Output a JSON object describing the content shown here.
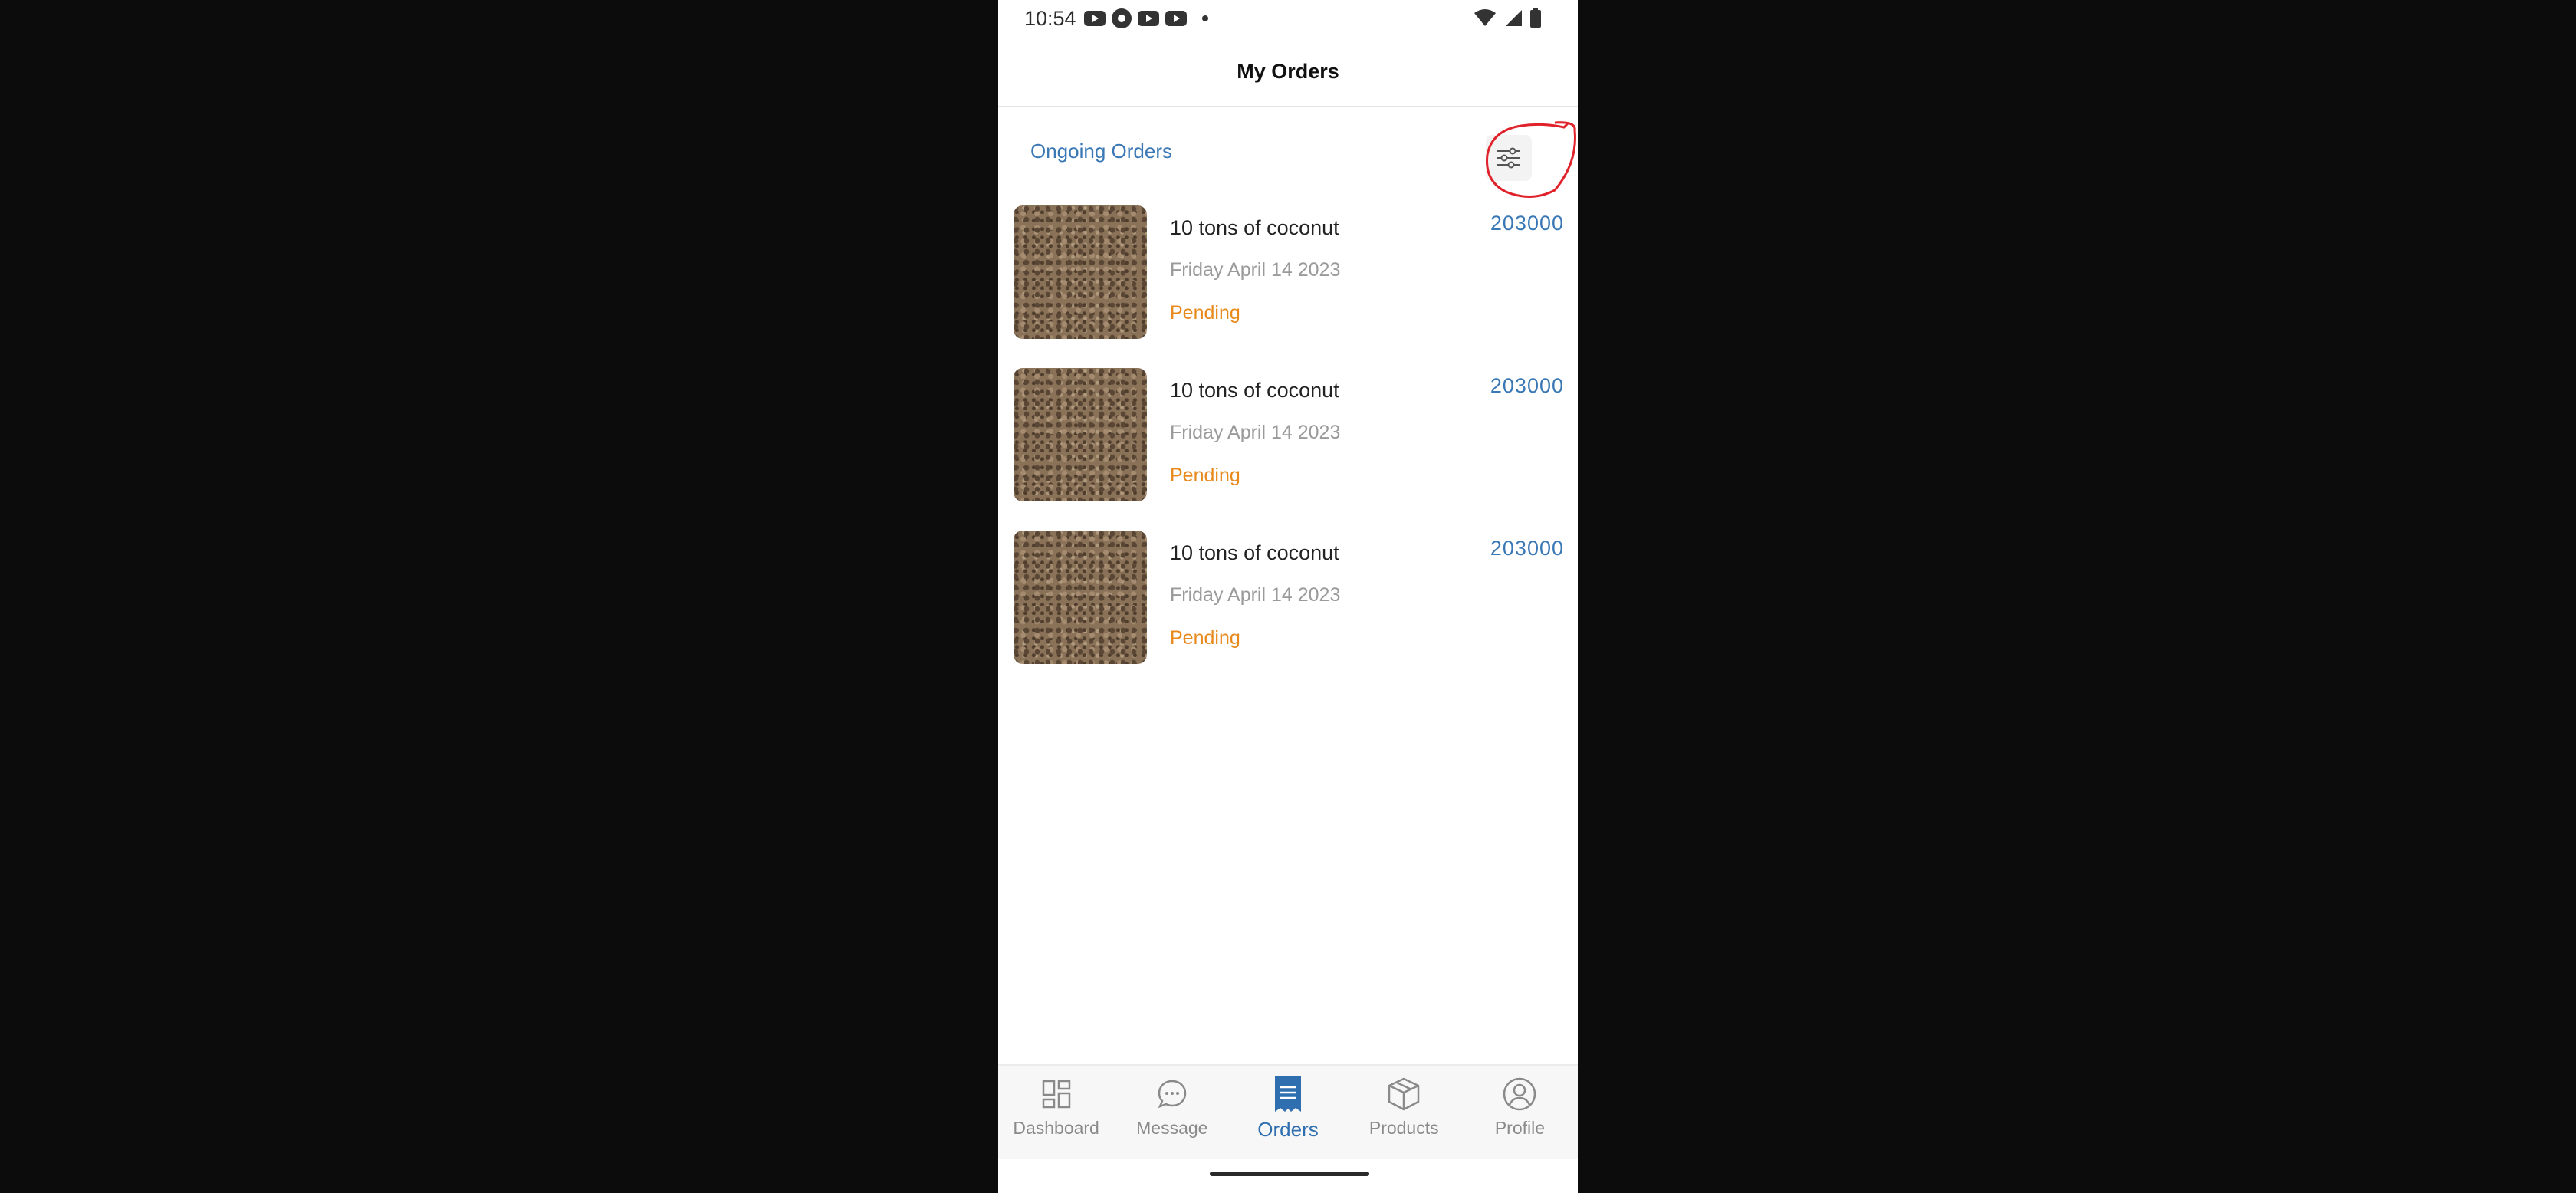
{
  "status_bar": {
    "time": "10:54",
    "icons_left": [
      "youtube-icon",
      "chrome-icon",
      "youtube-icon",
      "youtube-icon",
      "dot-icon"
    ],
    "icons_right": [
      "wifi-icon",
      "signal-icon",
      "battery-icon"
    ]
  },
  "header": {
    "title": "My Orders"
  },
  "section": {
    "title": "Ongoing Orders",
    "filter_icon": "sliders-icon"
  },
  "orders": [
    {
      "name": "10 tons of coconut",
      "date": "Friday April 14 2023",
      "status": "Pending",
      "price": "203000"
    },
    {
      "name": "10 tons of coconut",
      "date": "Friday April 14 2023",
      "status": "Pending",
      "price": "203000"
    },
    {
      "name": "10 tons of coconut",
      "date": "Friday April 14 2023",
      "status": "Pending",
      "price": "203000"
    }
  ],
  "nav": {
    "items": [
      {
        "label": "Dashboard",
        "icon": "dashboard-icon",
        "active": false
      },
      {
        "label": "Message",
        "icon": "message-icon",
        "active": false
      },
      {
        "label": "Orders",
        "icon": "orders-icon",
        "active": true
      },
      {
        "label": "Products",
        "icon": "box-icon",
        "active": false
      },
      {
        "label": "Profile",
        "icon": "profile-icon",
        "active": false
      }
    ]
  },
  "colors": {
    "accent": "#2f6fb0",
    "status_pending": "#e8891c",
    "annotation": "#e0232b"
  }
}
